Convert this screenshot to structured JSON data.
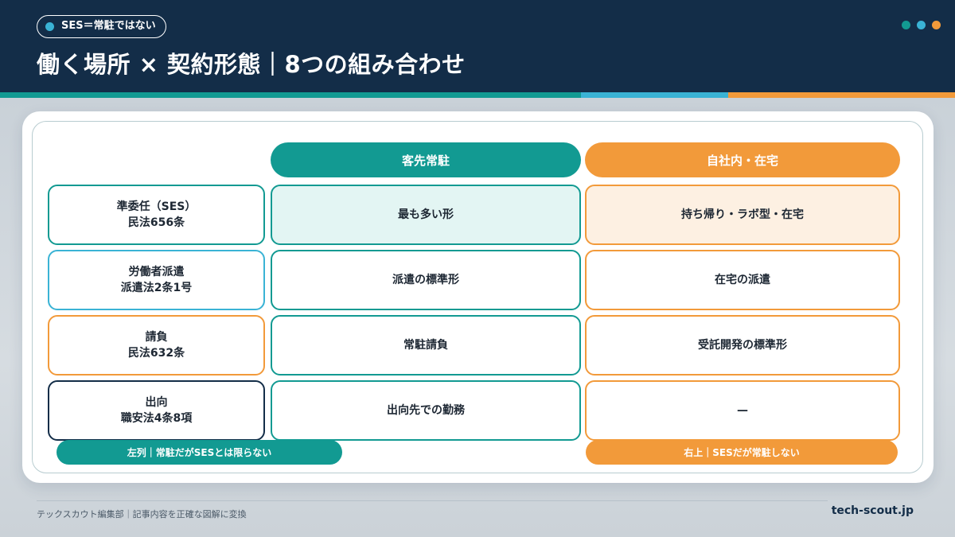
{
  "header": {
    "tag": "SES＝常駐ではない",
    "title": "働く場所 × 契約形態｜8つの組み合わせ",
    "dot_colors": [
      "#129a92",
      "#3ab3d5",
      "#f29a3a"
    ]
  },
  "colors": {
    "navy": "#132d48",
    "teal": "#129a92",
    "light_blue": "#3ab3d5",
    "orange": "#f29a3a",
    "teal_tint": "#e3f5f3",
    "orange_tint": "#fdf0e2"
  },
  "matrix": {
    "columns": [
      "客先常駐",
      "自社内・在宅"
    ],
    "rows": [
      {
        "label": "準委任（SES）",
        "law": "民法656条",
        "cells": [
          "最も多い形",
          "持ち帰り・ラボ型・在宅"
        ]
      },
      {
        "label": "労働者派遣",
        "law": "派遣法2条1号",
        "cells": [
          "派遣の標準形",
          "在宅の派遣"
        ]
      },
      {
        "label": "請負",
        "law": "民法632条",
        "cells": [
          "常駐請負",
          "受託開発の標準形"
        ]
      },
      {
        "label": "出向",
        "law": "職安法4条8項",
        "cells": [
          "出向先での勤務",
          "—"
        ]
      }
    ],
    "notes": {
      "left": "左列｜常駐だがSESとは限らない",
      "right": "右上｜SESだが常駐しない"
    }
  },
  "footer": {
    "left": "テックスカウト編集部｜記事内容を正確な図解に変換",
    "right": "tech-scout.jp"
  }
}
